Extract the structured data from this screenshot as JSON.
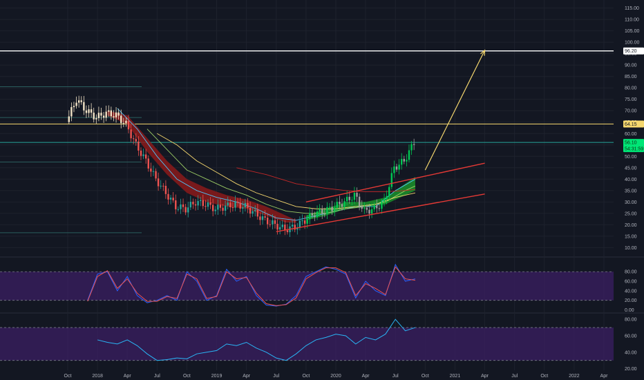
{
  "chart_data": [
    {
      "type": "candlestick",
      "title": "",
      "y_axis": {
        "ticks": [
          "115.00",
          "110.00",
          "105.00",
          "100.00",
          "95.00",
          "90.00",
          "85.00",
          "80.00",
          "75.00",
          "70.00",
          "65.00",
          "60.00",
          "55.00",
          "50.00",
          "45.00",
          "40.00",
          "35.00",
          "30.00",
          "25.00",
          "20.00",
          "15.00",
          "10.00"
        ],
        "range": [
          8,
          117
        ]
      },
      "x_axis": {
        "ticks": [
          "Oct",
          "2018",
          "Apr",
          "Jul",
          "Oct",
          "2019",
          "Apr",
          "Jul",
          "Oct",
          "2020",
          "Apr",
          "Jul",
          "Oct",
          "2021",
          "Apr",
          "Jul",
          "Oct",
          "2022",
          "Apr"
        ],
        "range": [
          "2017-10",
          "2022-04"
        ]
      },
      "price_labels": [
        {
          "text": "96.20",
          "value": 96.2,
          "color": "#ffffff"
        },
        {
          "text": "64.15",
          "value": 64.15,
          "color": "#f5d76e"
        },
        {
          "text": "56.10",
          "value": 56.1,
          "color": "#00e676"
        },
        {
          "text": "54:31:59",
          "value": 52.6,
          "color": "#00e676"
        }
      ],
      "horizontal_lines": [
        {
          "value": 96.2,
          "color": "#ffffff"
        },
        {
          "value": 64.15,
          "color": "#f5d76e"
        },
        {
          "value": 56.1,
          "color": "#26a69a"
        },
        {
          "value": 80.5,
          "color": "#2a5e5e"
        },
        {
          "value": 67.0,
          "color": "#2a5e5e"
        },
        {
          "value": 47.5,
          "color": "#2a5e5e"
        },
        {
          "value": 16.5,
          "color": "#2a5e5e"
        }
      ],
      "channel": {
        "upper": {
          "from": [
            "2019-10",
            30.0
          ],
          "to": [
            "2021-04",
            47.0
          ]
        },
        "lower": {
          "from": [
            "2019-07",
            17.0
          ],
          "to": [
            "2021-04",
            33.5
          ]
        },
        "color": "#e53935"
      },
      "projection_arrow": {
        "from": [
          "2020-10",
          44.0
        ],
        "to": [
          "2021-04",
          96.5
        ],
        "color": "#f5d76e"
      },
      "series_points": {
        "trend_close": [
          [
            "2017-10",
            65
          ],
          [
            "2017-11",
            75
          ],
          [
            "2017-12",
            70
          ],
          [
            "2018-01",
            67
          ],
          [
            "2018-02",
            69
          ],
          [
            "2018-03",
            68
          ],
          [
            "2018-04",
            64
          ],
          [
            "2018-05",
            55
          ],
          [
            "2018-06",
            48
          ],
          [
            "2018-07",
            40
          ],
          [
            "2018-08",
            34
          ],
          [
            "2018-09",
            28
          ],
          [
            "2018-10",
            27
          ],
          [
            "2018-11",
            30
          ],
          [
            "2018-12",
            29
          ],
          [
            "2019-01",
            27
          ],
          [
            "2019-02",
            28
          ],
          [
            "2019-03",
            29
          ],
          [
            "2019-04",
            28
          ],
          [
            "2019-05",
            25
          ],
          [
            "2019-06",
            22
          ],
          [
            "2019-07",
            20
          ],
          [
            "2019-08",
            18
          ],
          [
            "2019-09",
            19
          ],
          [
            "2019-10",
            22
          ],
          [
            "2019-11",
            25
          ],
          [
            "2019-12",
            26
          ],
          [
            "2020-01",
            28
          ],
          [
            "2020-02",
            30
          ],
          [
            "2020-03",
            33
          ],
          [
            "2020-04",
            26
          ],
          [
            "2020-05",
            27
          ],
          [
            "2020-06",
            30
          ],
          [
            "2020-07",
            45
          ],
          [
            "2020-08",
            48
          ],
          [
            "2020-09",
            56
          ]
        ],
        "ema_fast": [
          [
            "2018-03",
            71
          ],
          [
            "2018-05",
            62
          ],
          [
            "2018-07",
            50
          ],
          [
            "2018-09",
            40
          ],
          [
            "2018-11",
            35
          ],
          [
            "2019-01",
            32
          ],
          [
            "2019-03",
            30
          ],
          [
            "2019-05",
            27
          ],
          [
            "2019-07",
            23
          ],
          [
            "2019-09",
            22
          ],
          [
            "2019-11",
            24
          ],
          [
            "2020-01",
            26
          ],
          [
            "2020-03",
            28
          ],
          [
            "2020-05",
            28
          ],
          [
            "2020-07",
            35
          ],
          [
            "2020-09",
            40
          ]
        ],
        "ema_mid": [
          [
            "2018-06",
            62
          ],
          [
            "2018-08",
            53
          ],
          [
            "2018-10",
            44
          ],
          [
            "2018-12",
            40
          ],
          [
            "2019-02",
            36
          ],
          [
            "2019-04",
            33
          ],
          [
            "2019-06",
            29
          ],
          [
            "2019-08",
            26
          ],
          [
            "2019-10",
            25
          ],
          [
            "2019-12",
            25
          ],
          [
            "2020-02",
            27
          ],
          [
            "2020-04",
            28
          ],
          [
            "2020-06",
            30
          ],
          [
            "2020-08",
            35
          ],
          [
            "2020-09",
            37
          ]
        ],
        "ema_slow": [
          [
            "2018-07",
            60
          ],
          [
            "2018-09",
            55
          ],
          [
            "2018-11",
            48
          ],
          [
            "2019-01",
            43
          ],
          [
            "2019-03",
            38
          ],
          [
            "2019-05",
            34
          ],
          [
            "2019-07",
            31
          ],
          [
            "2019-09",
            28
          ],
          [
            "2019-11",
            27
          ],
          [
            "2020-01",
            27
          ],
          [
            "2020-03",
            28
          ],
          [
            "2020-05",
            29
          ],
          [
            "2020-07",
            32
          ],
          [
            "2020-09",
            34
          ]
        ],
        "sma_long": [
          [
            "2019-03",
            45
          ],
          [
            "2019-06",
            42
          ],
          [
            "2019-09",
            38
          ],
          [
            "2019-12",
            36
          ],
          [
            "2020-02",
            35
          ],
          [
            "2020-04",
            34.5
          ],
          [
            "2020-06",
            34.5
          ],
          [
            "2020-08",
            35
          ],
          [
            "2020-09",
            35.5
          ]
        ]
      }
    },
    {
      "type": "line",
      "title": "",
      "y_axis": {
        "ticks": [
          "80.00",
          "60.00",
          "40.00",
          "20.00",
          "0.00"
        ],
        "range": [
          -5,
          102
        ]
      },
      "band": {
        "upper": 80,
        "lower": 20,
        "color": "#3b1f63"
      },
      "series": [
        {
          "color": "#2962ff",
          "values": [
            [
              "2017-12",
              20
            ],
            [
              "2018-01",
              75
            ],
            [
              "2018-02",
              80
            ],
            [
              "2018-03",
              40
            ],
            [
              "2018-04",
              70
            ],
            [
              "2018-05",
              30
            ],
            [
              "2018-06",
              15
            ],
            [
              "2018-07",
              20
            ],
            [
              "2018-08",
              30
            ],
            [
              "2018-09",
              20
            ],
            [
              "2018-10",
              80
            ],
            [
              "2018-11",
              60
            ],
            [
              "2018-12",
              20
            ],
            [
              "2019-01",
              30
            ],
            [
              "2019-02",
              85
            ],
            [
              "2019-03",
              60
            ],
            [
              "2019-04",
              70
            ],
            [
              "2019-05",
              30
            ],
            [
              "2019-06",
              10
            ],
            [
              "2019-07",
              8
            ],
            [
              "2019-08",
              12
            ],
            [
              "2019-09",
              30
            ],
            [
              "2019-10",
              70
            ],
            [
              "2019-11",
              80
            ],
            [
              "2019-12",
              90
            ],
            [
              "2020-01",
              85
            ],
            [
              "2020-02",
              75
            ],
            [
              "2020-03",
              25
            ],
            [
              "2020-04",
              60
            ],
            [
              "2020-05",
              40
            ],
            [
              "2020-06",
              30
            ],
            [
              "2020-07",
              95
            ],
            [
              "2020-08",
              60
            ],
            [
              "2020-09",
              65
            ]
          ]
        },
        {
          "color": "#ef5350",
          "values": [
            [
              "2017-12",
              18
            ],
            [
              "2018-01",
              70
            ],
            [
              "2018-02",
              82
            ],
            [
              "2018-03",
              45
            ],
            [
              "2018-04",
              65
            ],
            [
              "2018-05",
              35
            ],
            [
              "2018-06",
              18
            ],
            [
              "2018-07",
              18
            ],
            [
              "2018-08",
              28
            ],
            [
              "2018-09",
              24
            ],
            [
              "2018-10",
              75
            ],
            [
              "2018-11",
              65
            ],
            [
              "2018-12",
              24
            ],
            [
              "2019-01",
              28
            ],
            [
              "2019-02",
              80
            ],
            [
              "2019-03",
              65
            ],
            [
              "2019-04",
              68
            ],
            [
              "2019-05",
              35
            ],
            [
              "2019-06",
              13
            ],
            [
              "2019-07",
              9
            ],
            [
              "2019-08",
              11
            ],
            [
              "2019-09",
              25
            ],
            [
              "2019-10",
              65
            ],
            [
              "2019-11",
              78
            ],
            [
              "2019-12",
              88
            ],
            [
              "2020-01",
              88
            ],
            [
              "2020-02",
              78
            ],
            [
              "2020-03",
              30
            ],
            [
              "2020-04",
              55
            ],
            [
              "2020-05",
              45
            ],
            [
              "2020-06",
              32
            ],
            [
              "2020-07",
              90
            ],
            [
              "2020-08",
              65
            ],
            [
              "2020-09",
              62
            ]
          ]
        }
      ]
    },
    {
      "type": "line",
      "title": "",
      "y_axis": {
        "ticks": [
          "80.00",
          "60.00",
          "40.00",
          "20.00"
        ],
        "range": [
          18,
          86
        ]
      },
      "band": {
        "upper": 70,
        "lower": 30,
        "color": "#3b1f63"
      },
      "series": [
        {
          "color": "#29b6f6",
          "values": [
            [
              "2018-01",
              55
            ],
            [
              "2018-02",
              52
            ],
            [
              "2018-03",
              50
            ],
            [
              "2018-04",
              55
            ],
            [
              "2018-05",
              48
            ],
            [
              "2018-06",
              38
            ],
            [
              "2018-07",
              30
            ],
            [
              "2018-08",
              31
            ],
            [
              "2018-09",
              33
            ],
            [
              "2018-10",
              32
            ],
            [
              "2018-11",
              38
            ],
            [
              "2018-12",
              40
            ],
            [
              "2019-01",
              42
            ],
            [
              "2019-02",
              50
            ],
            [
              "2019-03",
              48
            ],
            [
              "2019-04",
              52
            ],
            [
              "2019-05",
              45
            ],
            [
              "2019-06",
              40
            ],
            [
              "2019-07",
              33
            ],
            [
              "2019-08",
              30
            ],
            [
              "2019-09",
              38
            ],
            [
              "2019-10",
              48
            ],
            [
              "2019-11",
              55
            ],
            [
              "2019-12",
              58
            ],
            [
              "2020-01",
              62
            ],
            [
              "2020-02",
              60
            ],
            [
              "2020-03",
              50
            ],
            [
              "2020-04",
              58
            ],
            [
              "2020-05",
              55
            ],
            [
              "2020-06",
              62
            ],
            [
              "2020-07",
              80
            ],
            [
              "2020-08",
              66
            ],
            [
              "2020-09",
              70
            ]
          ]
        }
      ]
    }
  ],
  "colors": {
    "background": "#131722",
    "grid": "#1e222d",
    "axis_text": "#b2b5be",
    "bull": "#26a69a",
    "bear": "#ef5350",
    "candle_early": "#f2e3c6",
    "cloud_red": "#8b1a1a",
    "cloud_green": "#1b8a2a"
  }
}
